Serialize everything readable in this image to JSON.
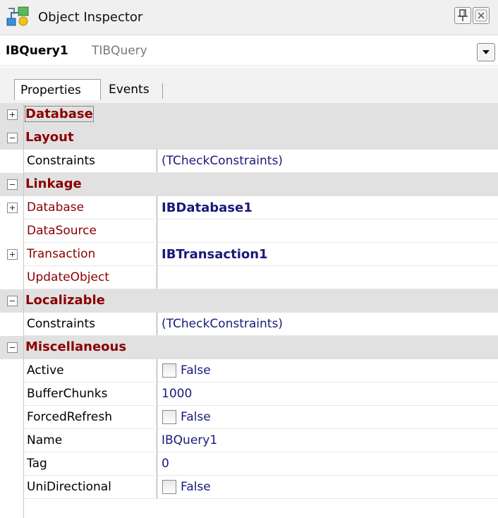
{
  "window": {
    "title": "Object Inspector",
    "icons": {
      "app": "object-inspector-icon",
      "pin": "pin-icon",
      "close": "close-icon"
    }
  },
  "object_selector": {
    "name": "IBQuery1",
    "type": "TIBQuery"
  },
  "tabs": [
    {
      "label": "Properties",
      "active": true
    },
    {
      "label": "Events",
      "active": false
    }
  ],
  "grid": {
    "rows": [
      {
        "kind": "category",
        "label": "Database",
        "expander": "plus"
      },
      {
        "kind": "category",
        "label": "Layout",
        "expander": "minus"
      },
      {
        "kind": "property",
        "name": "Constraints",
        "value": "(TCheckConstraints)"
      },
      {
        "kind": "category",
        "label": "Linkage",
        "expander": "minus"
      },
      {
        "kind": "property",
        "name": "Database",
        "value": "IBDatabase1",
        "expander": "plus"
      },
      {
        "kind": "property",
        "name": "DataSource",
        "value": ""
      },
      {
        "kind": "property",
        "name": "Transaction",
        "value": "IBTransaction1",
        "expander": "plus"
      },
      {
        "kind": "property",
        "name": "UpdateObject",
        "value": ""
      },
      {
        "kind": "category",
        "label": "Localizable",
        "expander": "minus"
      },
      {
        "kind": "property",
        "name": "Constraints",
        "value": "(TCheckConstraints)"
      },
      {
        "kind": "category",
        "label": "Miscellaneous",
        "expander": "minus"
      },
      {
        "kind": "property",
        "name": "Active",
        "value": "False",
        "checkbox": true
      },
      {
        "kind": "property",
        "name": "BufferChunks",
        "value": "1000"
      },
      {
        "kind": "property",
        "name": "ForcedRefresh",
        "value": "False",
        "checkbox": true
      },
      {
        "kind": "property",
        "name": "Name",
        "value": "IBQuery1"
      },
      {
        "kind": "property",
        "name": "Tag",
        "value": "0"
      },
      {
        "kind": "property",
        "name": "UniDirectional",
        "value": "False",
        "checkbox": true
      }
    ]
  },
  "colors": {
    "category_text": "#8b0000",
    "value_text": "#1a1a7a",
    "category_bg": "#e1e1e1"
  }
}
